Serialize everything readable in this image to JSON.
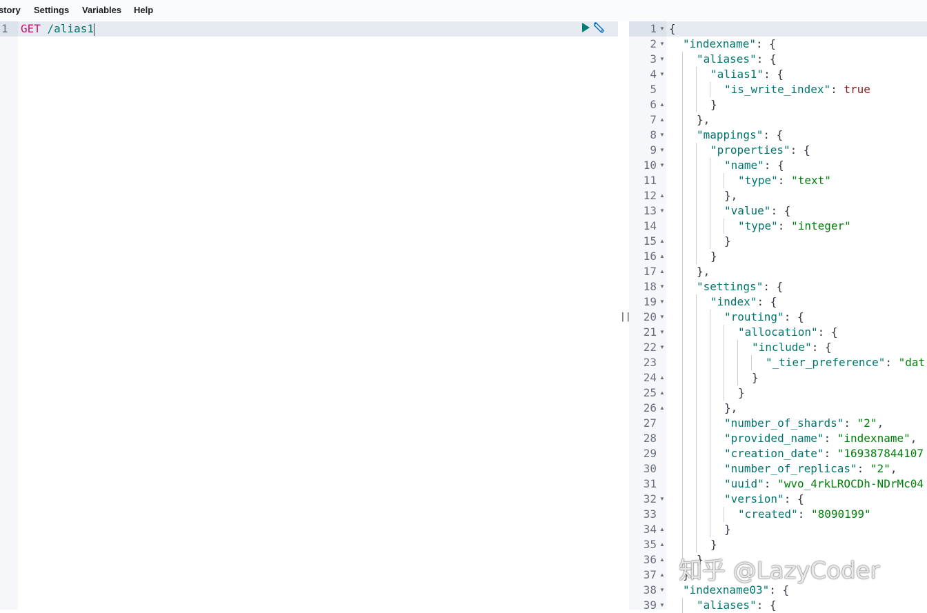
{
  "menu": {
    "items": [
      "story",
      "Settings",
      "Variables",
      "Help"
    ]
  },
  "request": {
    "line_number": "1",
    "method": "GET",
    "path": " /alias1",
    "run_icon": "play-icon",
    "tools_icon": "wrench-icon"
  },
  "divider": {
    "handle": "||"
  },
  "response": {
    "lines": [
      {
        "n": "1",
        "fold": "down",
        "d": 0,
        "html": "{"
      },
      {
        "n": "2",
        "fold": "down",
        "d": 1,
        "html": "<span class=\"k\">\"indexname\"</span>: {"
      },
      {
        "n": "3",
        "fold": "down",
        "d": 2,
        "html": "<span class=\"k\">\"aliases\"</span>: {"
      },
      {
        "n": "4",
        "fold": "down",
        "d": 3,
        "html": "<span class=\"k\">\"alias1\"</span>: {"
      },
      {
        "n": "5",
        "fold": "",
        "d": 4,
        "html": "<span class=\"k\">\"is_write_index\"</span>: <span class=\"b\">true</span>"
      },
      {
        "n": "6",
        "fold": "up",
        "d": 3,
        "html": "}"
      },
      {
        "n": "7",
        "fold": "up",
        "d": 2,
        "html": "},"
      },
      {
        "n": "8",
        "fold": "down",
        "d": 2,
        "html": "<span class=\"k\">\"mappings\"</span>: {"
      },
      {
        "n": "9",
        "fold": "down",
        "d": 3,
        "html": "<span class=\"k\">\"properties\"</span>: {"
      },
      {
        "n": "10",
        "fold": "down",
        "d": 4,
        "html": "<span class=\"k\">\"name\"</span>: {"
      },
      {
        "n": "11",
        "fold": "",
        "d": 5,
        "html": "<span class=\"k\">\"type\"</span>: <span class=\"s\">\"text\"</span>"
      },
      {
        "n": "12",
        "fold": "up",
        "d": 4,
        "html": "},"
      },
      {
        "n": "13",
        "fold": "down",
        "d": 4,
        "html": "<span class=\"k\">\"value\"</span>: {"
      },
      {
        "n": "14",
        "fold": "",
        "d": 5,
        "html": "<span class=\"k\">\"type\"</span>: <span class=\"s\">\"integer\"</span>"
      },
      {
        "n": "15",
        "fold": "up",
        "d": 4,
        "html": "}"
      },
      {
        "n": "16",
        "fold": "up",
        "d": 3,
        "html": "}"
      },
      {
        "n": "17",
        "fold": "up",
        "d": 2,
        "html": "},"
      },
      {
        "n": "18",
        "fold": "down",
        "d": 2,
        "html": "<span class=\"k\">\"settings\"</span>: {"
      },
      {
        "n": "19",
        "fold": "down",
        "d": 3,
        "html": "<span class=\"k\">\"index\"</span>: {"
      },
      {
        "n": "20",
        "fold": "down",
        "d": 4,
        "html": "<span class=\"k\">\"routing\"</span>: {"
      },
      {
        "n": "21",
        "fold": "down",
        "d": 5,
        "html": "<span class=\"k\">\"allocation\"</span>: {"
      },
      {
        "n": "22",
        "fold": "down",
        "d": 6,
        "html": "<span class=\"k\">\"include\"</span>: {"
      },
      {
        "n": "23",
        "fold": "",
        "d": 7,
        "html": "<span class=\"k\">\"_tier_preference\"</span>: <span class=\"s\">\"dat</span>"
      },
      {
        "n": "24",
        "fold": "up",
        "d": 6,
        "html": "}"
      },
      {
        "n": "25",
        "fold": "up",
        "d": 5,
        "html": "}"
      },
      {
        "n": "26",
        "fold": "up",
        "d": 4,
        "html": "},"
      },
      {
        "n": "27",
        "fold": "",
        "d": 4,
        "html": "<span class=\"k\">\"number_of_shards\"</span>: <span class=\"s\">\"2\"</span>,"
      },
      {
        "n": "28",
        "fold": "",
        "d": 4,
        "html": "<span class=\"k\">\"provided_name\"</span>: <span class=\"s\">\"indexname\"</span>,"
      },
      {
        "n": "29",
        "fold": "",
        "d": 4,
        "html": "<span class=\"k\">\"creation_date\"</span>: <span class=\"s\">\"169387844107</span>"
      },
      {
        "n": "30",
        "fold": "",
        "d": 4,
        "html": "<span class=\"k\">\"number_of_replicas\"</span>: <span class=\"s\">\"2\"</span>,"
      },
      {
        "n": "31",
        "fold": "",
        "d": 4,
        "html": "<span class=\"k\">\"uuid\"</span>: <span class=\"s\">\"wvo_4rkLROCDh-NDrMc04</span>"
      },
      {
        "n": "32",
        "fold": "down",
        "d": 4,
        "html": "<span class=\"k\">\"version\"</span>: {"
      },
      {
        "n": "33",
        "fold": "",
        "d": 5,
        "html": "<span class=\"k\">\"created\"</span>: <span class=\"s\">\"8090199\"</span>"
      },
      {
        "n": "34",
        "fold": "up",
        "d": 4,
        "html": "}"
      },
      {
        "n": "35",
        "fold": "up",
        "d": 3,
        "html": "}"
      },
      {
        "n": "36",
        "fold": "up",
        "d": 2,
        "html": "}"
      },
      {
        "n": "37",
        "fold": "up",
        "d": 1,
        "html": "},"
      },
      {
        "n": "38",
        "fold": "down",
        "d": 1,
        "html": "<span class=\"k\">\"indexname03\"</span>: {"
      },
      {
        "n": "39",
        "fold": "down",
        "d": 2,
        "html": "<span class=\"k\">\"aliases\"</span>: {"
      }
    ]
  },
  "watermark": "知乎 @LazyCoder"
}
